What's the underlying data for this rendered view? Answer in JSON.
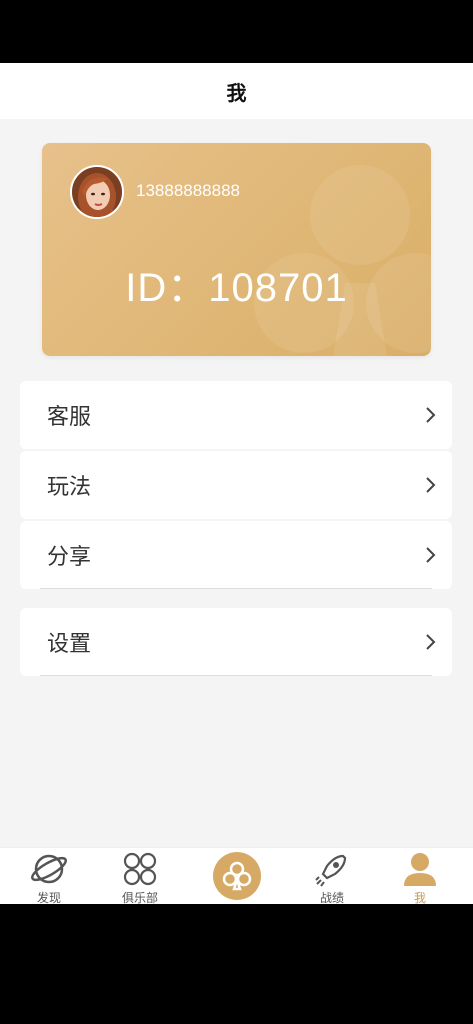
{
  "header": {
    "title": "我"
  },
  "card": {
    "phone": "13888888888",
    "user_id": "ID：108701"
  },
  "menu": [
    {
      "label": "客服"
    },
    {
      "label": "玩法"
    },
    {
      "label": "分享"
    },
    {
      "label": "设置"
    }
  ],
  "tabbar": {
    "tabs": [
      {
        "label": "发现",
        "icon": "planet-icon"
      },
      {
        "label": "俱乐部",
        "icon": "four-circles-icon"
      },
      {
        "label": "",
        "icon": "club-suit-icon"
      },
      {
        "label": "战绩",
        "icon": "rocket-icon"
      },
      {
        "label": "我",
        "icon": "person-icon"
      }
    ]
  },
  "colors": {
    "accent": "#c69a56",
    "card_gold": "#dfb674",
    "background": "#f4f4f4"
  }
}
